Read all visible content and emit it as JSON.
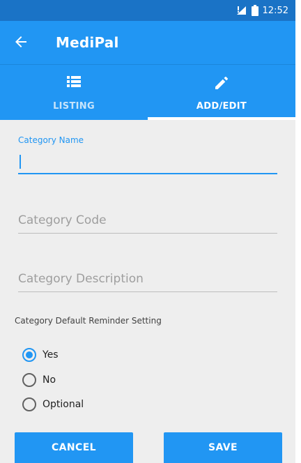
{
  "status_bar": {
    "time": "12:52",
    "signal_icon": "cellular-signal-icon",
    "battery_icon": "battery-icon"
  },
  "app_bar": {
    "title": "MediPal",
    "back_icon": "arrow-back-icon"
  },
  "tabs": [
    {
      "label": "LISTING",
      "icon": "list-icon",
      "active": false
    },
    {
      "label": "ADD/EDIT",
      "icon": "pencil-icon",
      "active": true
    }
  ],
  "form": {
    "category_name": {
      "label": "Category Name",
      "value": ""
    },
    "category_code": {
      "placeholder": "Category Code",
      "value": ""
    },
    "category_description": {
      "placeholder": "Category Description",
      "value": ""
    },
    "reminder_setting": {
      "label": "Category Default Reminder Setting",
      "options": [
        {
          "label": "Yes",
          "selected": true
        },
        {
          "label": "No",
          "selected": false
        },
        {
          "label": "Optional",
          "selected": false
        }
      ]
    }
  },
  "actions": {
    "cancel_label": "CANCEL",
    "save_label": "SAVE"
  },
  "colors": {
    "primary": "#2196f3",
    "status_bar": "#1a73c6",
    "background": "#eeeeee"
  }
}
